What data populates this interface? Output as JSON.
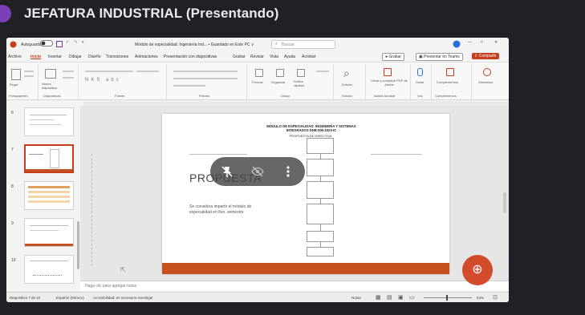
{
  "meeting": {
    "title": "JEFATURA INDUSTRIAL (Presentando)"
  },
  "app": {
    "autosave_label": "Autoguardado",
    "file_title": "Módulo de especialidad: Ingeniería Ind... • Guardado en Este PC ∨",
    "search_placeholder": "Buscar",
    "window_controls": [
      "—",
      "□",
      "✕"
    ]
  },
  "menu": {
    "items": [
      "Archivo",
      "Inicio",
      "Insertar",
      "Dibujar",
      "Diseño",
      "Transiciones",
      "Animaciones",
      "Presentación con diapositivas",
      "Grabar",
      "Revisar",
      "Vista",
      "Ayuda",
      "Acrobat"
    ],
    "record_label": "Grabar",
    "present_label": "Presentar en Teams",
    "share_label": "Compartir"
  },
  "ribbon": {
    "groups": [
      "Portapapeles",
      "Diapositivas",
      "Fuente",
      "Párrafo",
      "Dibujo",
      "Edición",
      "Adobe Acrobat",
      "Voz",
      "Complementos"
    ],
    "buttons": [
      "Pegar",
      "Nueva diapositiva",
      "Formas",
      "Organizar",
      "Estilos rápidos",
      "Edición",
      "Crear y compartir PDF de Adobe",
      "Dictar",
      "Complementos",
      "Diseñador"
    ]
  },
  "thumbnails": {
    "numbers": [
      "6",
      "7",
      "8",
      "9",
      "10"
    ],
    "active_index": 1
  },
  "slide": {
    "heading": "MÓDULO DE ESPECIALIDAD: INGENIERÍA Y SISTEMAS INTEGRADOS DNB 006-2023-IC",
    "subheading": "PROPUESTA DE DIRECTIVA",
    "title": "PROPUESTA",
    "body": "Se considera impartir el módulo de especialidad en 8vo. semestre"
  },
  "notes": {
    "placeholder": "Haga clic para agregar notas"
  },
  "status": {
    "slide_indicator": "Diapositiva 7 de 10",
    "language": "Español (México)",
    "accessibility": "Accesibilidad: es necesario investigar",
    "notes_btn": "Notas",
    "zoom": "54%"
  },
  "overlay": {
    "icons": [
      "pin-off-icon",
      "eye-off-icon",
      "more-vert-icon"
    ]
  },
  "colors": {
    "accent": "#c5521e",
    "meet_bg": "#202124",
    "fab": "#d24b2b"
  }
}
